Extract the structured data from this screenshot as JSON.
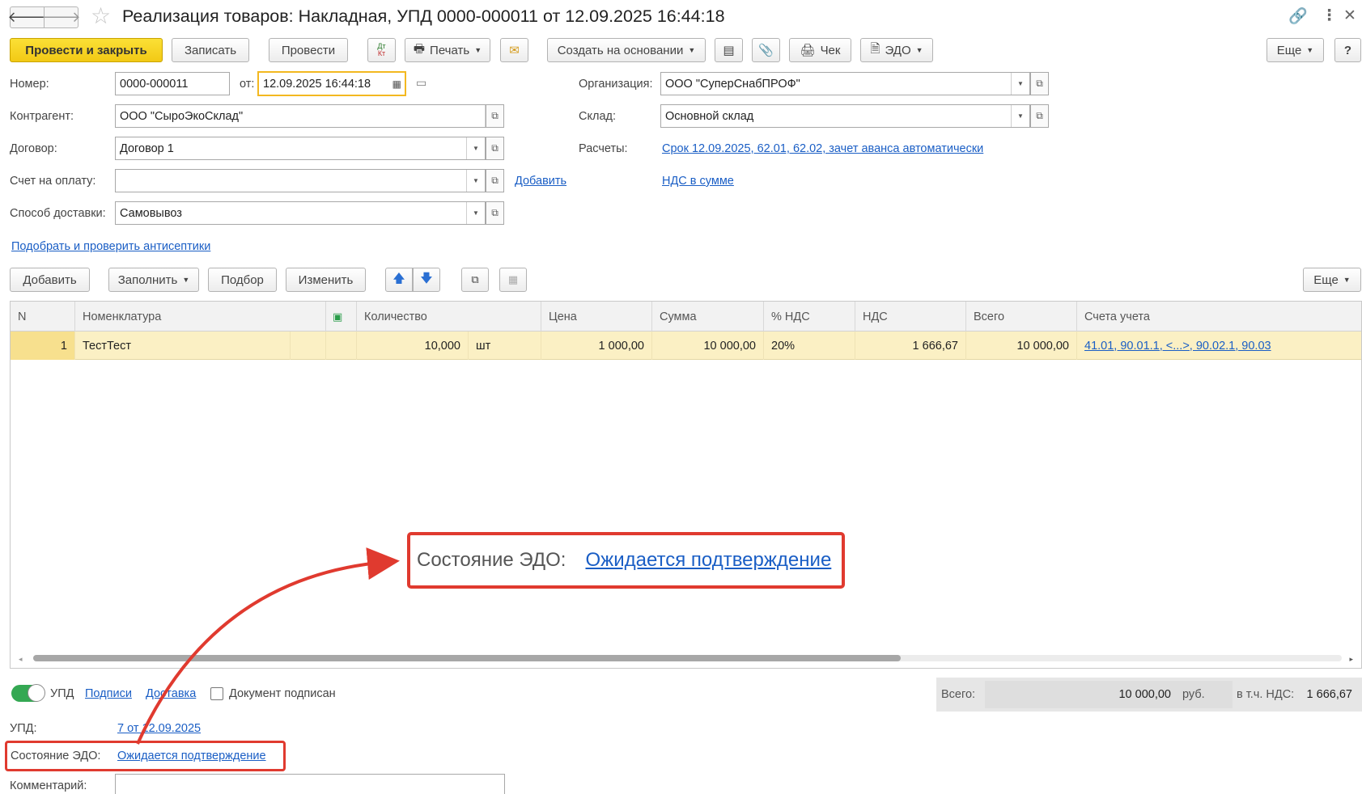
{
  "window": {
    "title": "Реализация товаров: Накладная, УПД 0000-000011 от 12.09.2025 16:44:18",
    "back_icon": "arrow-left-icon",
    "forward_icon": "arrow-right-icon"
  },
  "toolbar": {
    "post_close": "Провести и закрыть",
    "save": "Записать",
    "post": "Провести",
    "dtkt": "Дт Кт",
    "print": "Печать",
    "create_based": "Создать на основании",
    "receipt": "Чек",
    "edo": "ЭДО",
    "more": "Еще",
    "help": "?"
  },
  "form": {
    "number_label": "Номер:",
    "number_value": "0000-000011",
    "from_label": "от:",
    "date_value": "12.09.2025 16:44:18",
    "org_label": "Организация:",
    "org_value": "ООО \"СуперСнабПРОФ\"",
    "counterparty_label": "Контрагент:",
    "counterparty_value": "ООО \"СыроЭкоСклад\"",
    "warehouse_label": "Склад:",
    "warehouse_value": "Основной склад",
    "contract_label": "Договор:",
    "contract_value": "Договор 1",
    "settlements_label": "Расчеты:",
    "settlements_link": "Срок 12.09.2025, 62.01, 62.02, зачет аванса автоматически",
    "invoice_label": "Счет на оплату:",
    "invoice_value": "",
    "add_link": "Добавить",
    "vat_link": "НДС в сумме",
    "delivery_label": "Способ доставки:",
    "delivery_value": "Самовывоз",
    "antiseptic_link": "Подобрать и проверить антисептики"
  },
  "table_toolbar": {
    "add": "Добавить",
    "fill": "Заполнить",
    "pick": "Подбор",
    "change": "Изменить",
    "more": "Еще"
  },
  "table": {
    "headers": {
      "n": "N",
      "item": "Номенклатура",
      "qty": "Количество",
      "price": "Цена",
      "sum": "Сумма",
      "vat_rate": "% НДС",
      "vat": "НДС",
      "total": "Всего",
      "accounts": "Счета учета"
    },
    "rows": [
      {
        "n": "1",
        "item": "ТестТест",
        "qty": "10,000",
        "unit": "шт",
        "price": "1 000,00",
        "sum": "10 000,00",
        "vat_rate": "20%",
        "vat": "1 666,67",
        "total": "10 000,00",
        "accounts": "41.01, 90.01.1, <...>, 90.02.1, 90.03"
      }
    ]
  },
  "callout": {
    "label": "Состояние ЭДО:",
    "link": "Ожидается подтверждение"
  },
  "bottom": {
    "upd_toggle": "УПД",
    "signatures_link": "Подписи",
    "delivery_link": "Доставка",
    "signed_checkbox": "Документ подписан",
    "upd_label": "УПД:",
    "upd_link": "7 от 12.09.2025",
    "edo_state_label": "Состояние ЭДО:",
    "edo_state_link": "Ожидается подтверждение",
    "comment_label": "Комментарий:",
    "comment_value": ""
  },
  "totals": {
    "total_label": "Всего:",
    "total_value": "10 000,00",
    "currency": "руб.",
    "vat_label": "в т.ч. НДС:",
    "vat_value": "1 666,67"
  },
  "colors": {
    "primary_button": "#f2c915",
    "selected_row": "#fbf0c4",
    "link": "#1a5ec5",
    "highlight_red": "#e03a2f",
    "toggle_on": "#34a853"
  }
}
